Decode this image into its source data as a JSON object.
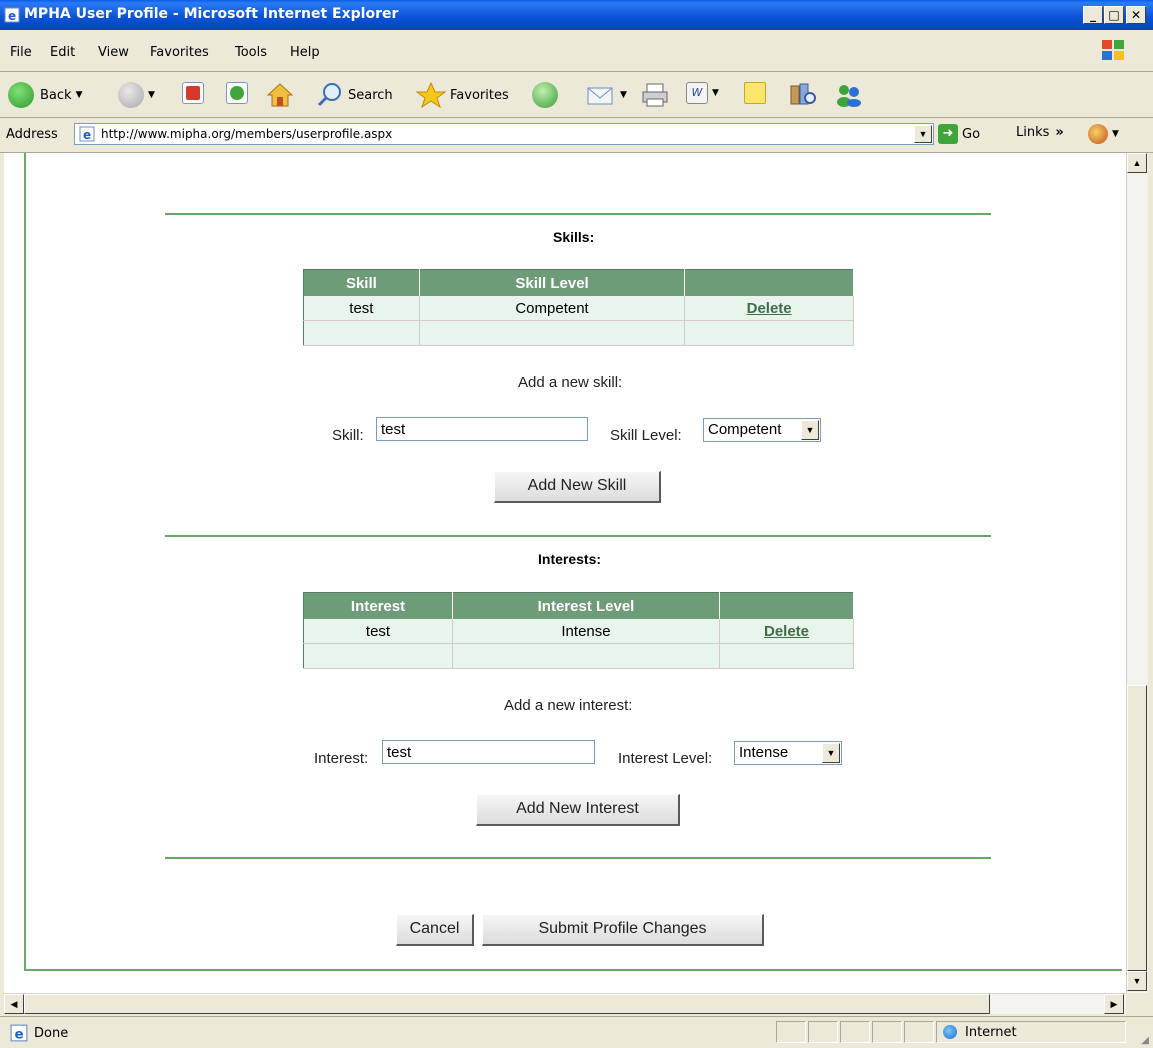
{
  "window": {
    "title": "MPHA User Profile - Microsoft Internet Explorer"
  },
  "menu": [
    "File",
    "Edit",
    "View",
    "Favorites",
    "Tools",
    "Help"
  ],
  "toolbar": {
    "back": "Back",
    "search": "Search",
    "favorites": "Favorites"
  },
  "address": {
    "label": "Address",
    "url": "http://www.mipha.org/members/userprofile.aspx",
    "go": "Go",
    "links": "Links"
  },
  "skills": {
    "title": "Skills:",
    "headers": [
      "Skill",
      "Skill Level",
      ""
    ],
    "rows": [
      {
        "skill": "test",
        "level": "Competent",
        "action": "Delete"
      }
    ],
    "add_prompt": "Add a new skill:",
    "skill_label": "Skill:",
    "skill_value": "test",
    "level_label": "Skill Level:",
    "level_value": "Competent",
    "add_button": "Add New Skill"
  },
  "interests": {
    "title": "Interests:",
    "headers": [
      "Interest",
      "Interest Level",
      ""
    ],
    "rows": [
      {
        "interest": "test",
        "level": "Intense",
        "action": "Delete"
      }
    ],
    "add_prompt": "Add a new interest:",
    "interest_label": "Interest:",
    "interest_value": "test",
    "level_label": "Interest Level:",
    "level_value": "Intense",
    "add_button": "Add New Interest"
  },
  "actions": {
    "cancel": "Cancel",
    "submit": "Submit Profile Changes"
  },
  "status": {
    "text": "Done",
    "zone": "Internet"
  }
}
